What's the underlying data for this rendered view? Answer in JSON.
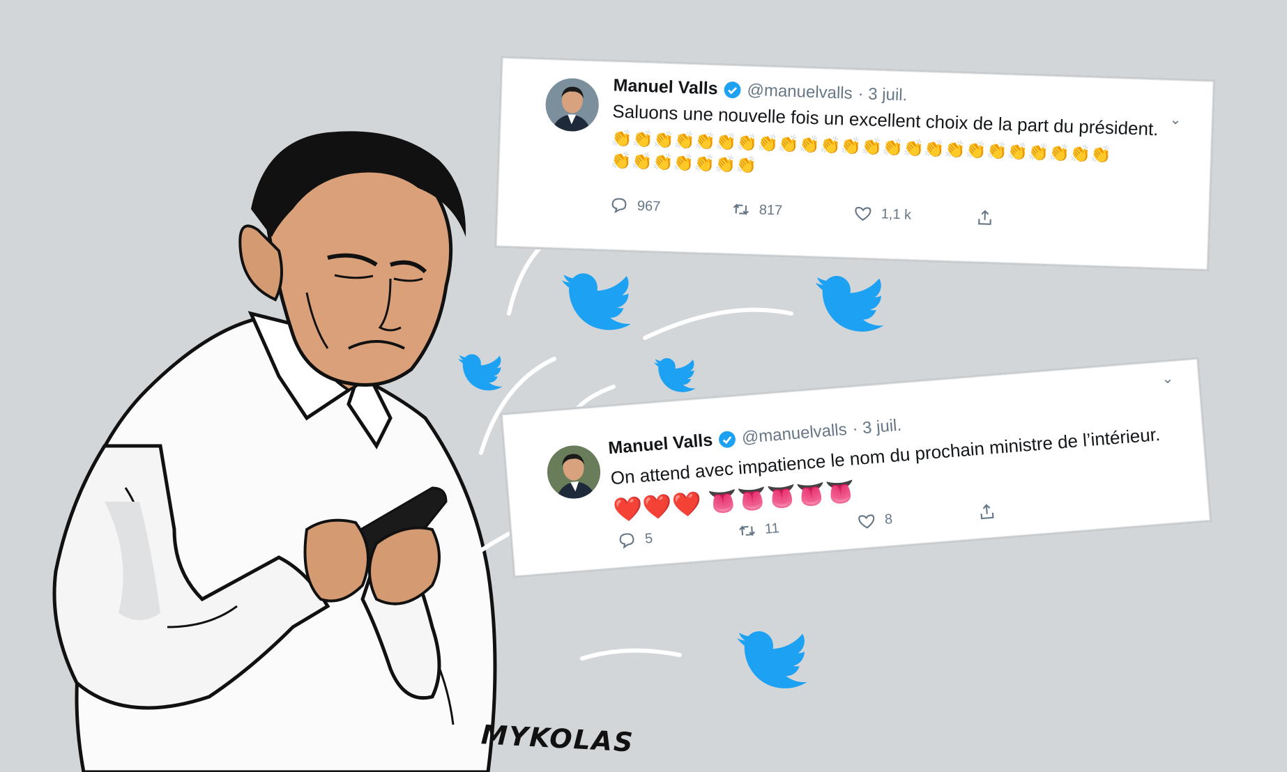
{
  "colors": {
    "background": "#d3d6d9",
    "twitter_blue": "#1da1f2",
    "text": "#14171a",
    "muted": "#657786"
  },
  "tweets": [
    {
      "name": "Manuel Valls",
      "handle": "@manuelvalls",
      "date": "· 3 juil.",
      "text": "Saluons une nouvelle fois un excellent choix de la part du président.",
      "emoji_rows": [
        "👏👏👏👏👏👏👏👏👏👏👏👏👏👏👏👏👏👏👏👏👏👏👏👏",
        "👏👏👏👏👏👏👏"
      ],
      "replies": "967",
      "retweets": "817",
      "likes": "1,1 k"
    },
    {
      "name": "Manuel Valls",
      "handle": "@manuelvalls",
      "date": "· 3 juil.",
      "text": "On attend avec impatience le nom du prochain ministre de l’intérieur.",
      "emoji_rows": [
        "❤️❤️❤️ 👅👅👅👅👅"
      ],
      "replies": "5",
      "retweets": "11",
      "likes": "8"
    }
  ],
  "signature": "MYKOLAS",
  "icons": [
    "verified-badge-icon",
    "chevron-down-icon",
    "reply-icon",
    "retweet-icon",
    "like-icon",
    "share-icon",
    "twitter-bird-icon"
  ]
}
